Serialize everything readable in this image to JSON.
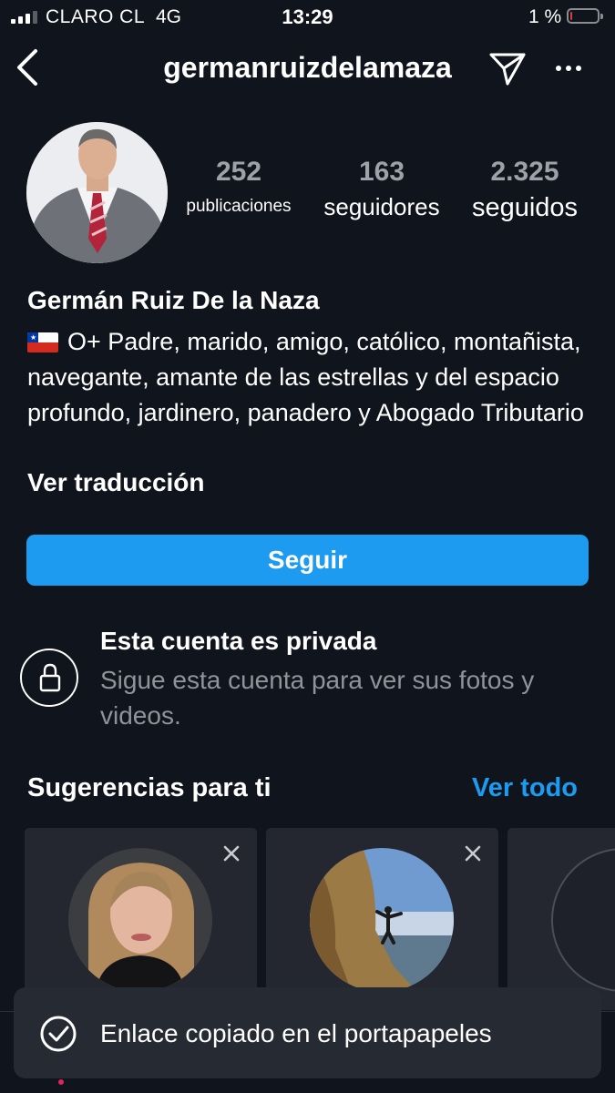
{
  "status_bar": {
    "carrier": "CLARO CL",
    "network": "4G",
    "time": "13:29",
    "battery_text": "1 %",
    "battery_level": 0.01,
    "battery_color": "#e03a3a"
  },
  "header": {
    "username": "germanruizdelamaza",
    "back_icon": "chevron-left-icon",
    "send_icon": "paper-plane-icon",
    "more_icon": "more-horizontal-icon"
  },
  "profile": {
    "stats": {
      "posts_count": "252",
      "posts_label": "publicaciones",
      "followers_count": "163",
      "followers_label": "seguidores",
      "following_count": "2.325",
      "following_label": "seguidos"
    },
    "full_name": "Germán Ruiz De la Naza",
    "bio_flag": "chile-flag-icon",
    "bio_text": "O+ Padre, marido, amigo, católico, montañista, navegante, amante de las estrellas y del espacio profundo, jardinero, panadero y Abogado Tributario",
    "translate_label": "Ver traducción",
    "follow_label": "Seguir"
  },
  "private_account": {
    "icon": "lock-icon",
    "title": "Esta cuenta es privada",
    "description": "Sigue esta cuenta para ver sus fotos y videos."
  },
  "suggestions": {
    "title": "Sugerencias para ti",
    "see_all_label": "Ver todo"
  },
  "toast": {
    "icon": "checkmark-circle-icon",
    "message": "Enlace copiado en el portapapeles"
  },
  "colors": {
    "background": "#10141c",
    "accent_blue": "#1d9bf0",
    "muted_text": "#8f949b",
    "card_background": "#242730",
    "toast_background": "#262a33"
  }
}
